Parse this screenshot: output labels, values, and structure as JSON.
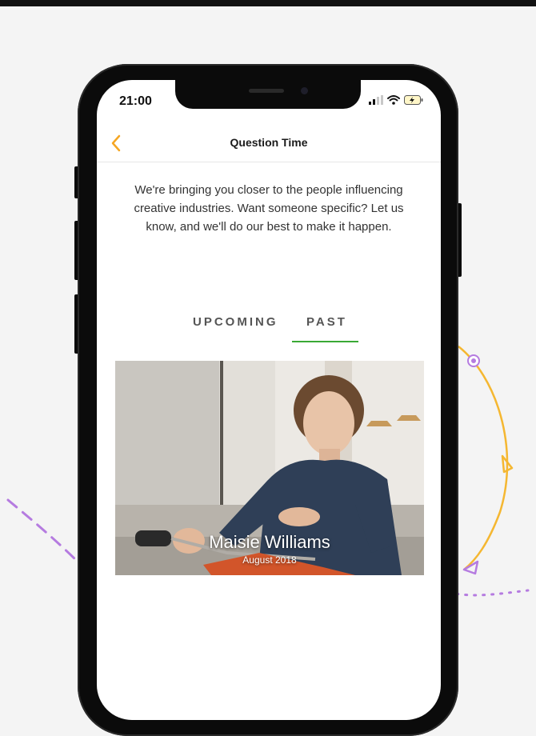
{
  "status_bar": {
    "time": "21:00"
  },
  "nav": {
    "title": "Question Time",
    "back_icon": "chevron-left-icon"
  },
  "intro_text": "We're bringing you closer to the people influencing creative industries. Want someone specific? Let us know, and we'll do our best to make it happen.",
  "tabs": [
    {
      "label": "UPCOMING",
      "selected": false
    },
    {
      "label": "PAST",
      "selected": true
    }
  ],
  "cards": [
    {
      "name": "Maisie Williams",
      "date": "August 2018"
    }
  ],
  "colors": {
    "accent": "#f5a623",
    "tab_indicator": "#3aa935",
    "deco_purple": "#b57be0",
    "deco_orange": "#f5b731"
  }
}
